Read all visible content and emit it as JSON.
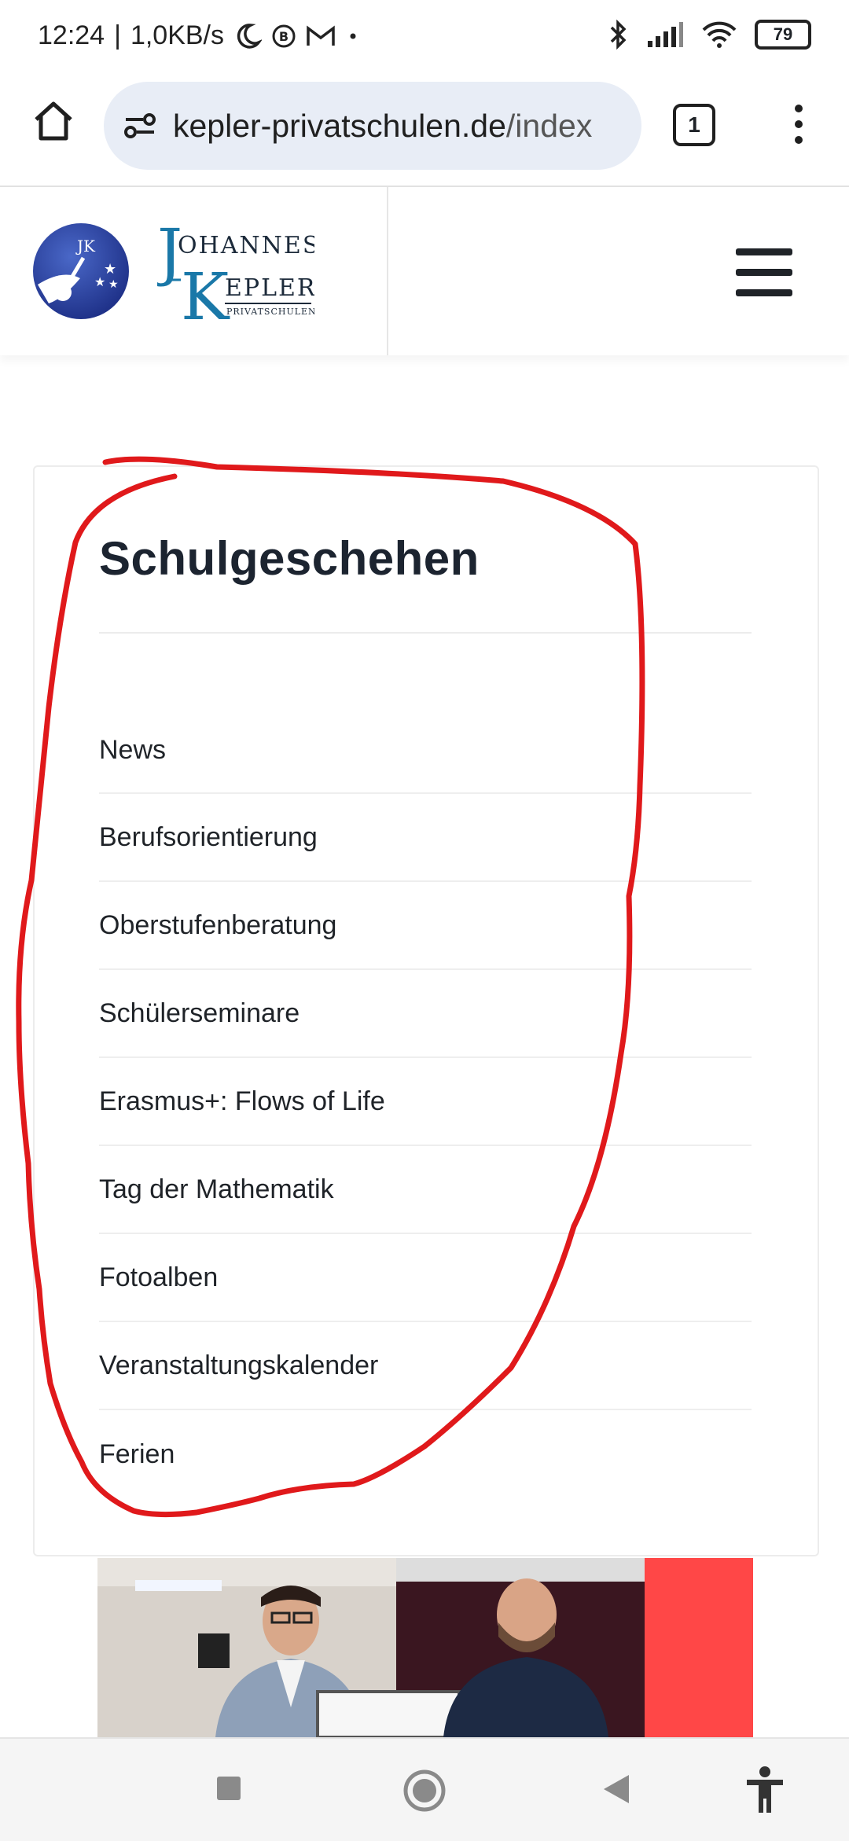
{
  "status_bar": {
    "time": "12:24",
    "network_speed": "1,0KB/s",
    "battery": "79",
    "icons": [
      "moon-icon",
      "b-icon",
      "gmail-icon",
      "dot-icon",
      "bluetooth-icon",
      "signal-icon",
      "wifi-icon",
      "battery-icon"
    ]
  },
  "browser": {
    "url_domain": "kepler-privatschulen.de",
    "url_path": "/index",
    "tab_count": "1"
  },
  "site": {
    "logo_monogram": "JK",
    "logo_line1": "OHANNES",
    "logo_line2": "EPLER",
    "logo_line3": "PRIVATSCHULEN"
  },
  "section": {
    "title": "Schulgeschehen",
    "items": [
      {
        "label": "News"
      },
      {
        "label": "Berufsorientierung"
      },
      {
        "label": "Oberstufenberatung"
      },
      {
        "label": "Schülerseminare"
      },
      {
        "label": "Erasmus+: Flows of Life"
      },
      {
        "label": "Tag der Mathematik"
      },
      {
        "label": "Fotoalben"
      },
      {
        "label": "Veranstaltungskalender"
      },
      {
        "label": "Ferien"
      }
    ]
  },
  "colors": {
    "annotation": "#e0191b",
    "logo_blue": "#1a78a8",
    "photo_red": "#ff4747"
  }
}
